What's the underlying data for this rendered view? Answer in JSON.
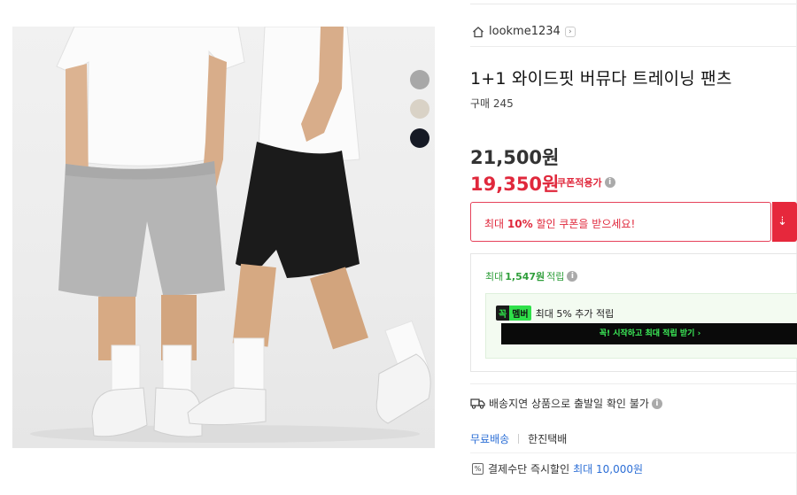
{
  "product_image": {
    "swatches": [
      {
        "name": "gray",
        "color": "#a8a8a8"
      },
      {
        "name": "beige",
        "color": "#d9d2c6"
      },
      {
        "name": "navy-black",
        "color": "#161a25"
      }
    ]
  },
  "store": {
    "name": "lookme1234",
    "chevron": "›"
  },
  "product": {
    "title": "1+1 와이드핏 버뮤다 트레이닝 팬츠",
    "purchase_count": "구매 245"
  },
  "pricing": {
    "original_price": "21,500원",
    "sale_price": "19,350원",
    "coupon_applicable": "쿠폰적용가"
  },
  "coupon": {
    "prefix": "최대 ",
    "highlight": "10%",
    "suffix": " 할인 쿠폰을 받으세요!",
    "download_icon": "⇣"
  },
  "points": {
    "prefix": "최대 ",
    "amount": "1,547원",
    "suffix": " 적립"
  },
  "membership": {
    "badge_left": "꼭",
    "badge_right": "멤버",
    "text": "최대 5% 추가 적립",
    "cta": "꼭! 시작하고 최대 적립 받기 ›"
  },
  "delivery": {
    "notice": "배송지연 상품으로 출발일 확인 불가",
    "free_shipping": "무료배송",
    "courier": "한진택배"
  },
  "payment_discount": {
    "icon": "%",
    "label": "결제수단 즉시할인",
    "max": "최대 10,000원"
  },
  "colors": {
    "sale_red": "#e0283c",
    "points_green": "#2e9e3a",
    "link_blue": "#2d6fd6",
    "member_green": "#2fe04a"
  }
}
